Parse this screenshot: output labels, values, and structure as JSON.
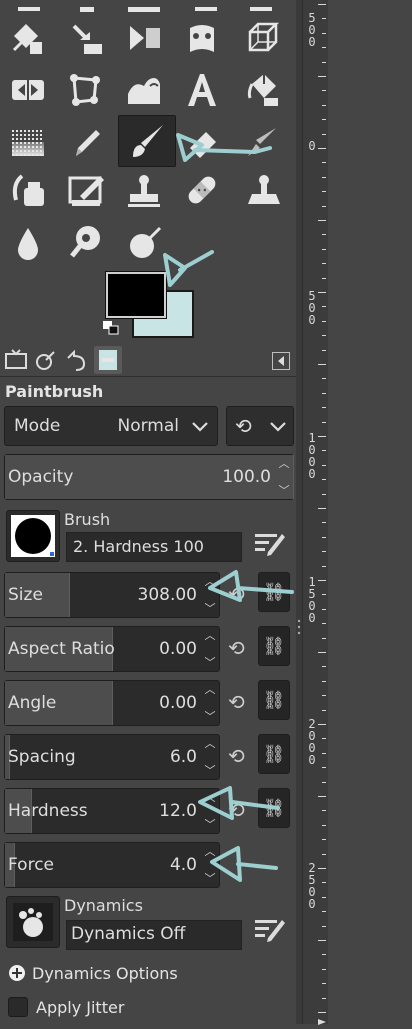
{
  "ruler": {
    "labels": [
      "500",
      "0",
      "500",
      "1000",
      "1500",
      "2000",
      "2500"
    ]
  },
  "tabs": {
    "panel_menu_icon": "panel-menu-icon"
  },
  "tool_options": {
    "title": "Paintbrush",
    "mode": {
      "label": "Mode",
      "value": "Normal"
    },
    "opacity": {
      "label": "Opacity",
      "value": "100.0",
      "fraction": 1.0
    },
    "brush": {
      "label": "Brush",
      "value": "2. Hardness 100"
    },
    "size": {
      "label": "Size",
      "value": "308.00",
      "fraction": 0.3
    },
    "aspect_ratio": {
      "label": "Aspect Ratio",
      "value": "0.00",
      "fraction": 0.5
    },
    "angle": {
      "label": "Angle",
      "value": "0.00",
      "fraction": 0.5
    },
    "spacing": {
      "label": "Spacing",
      "value": "6.0",
      "fraction": 0.02
    },
    "hardness": {
      "label": "Hardness",
      "value": "12.0",
      "fraction": 0.12
    },
    "force": {
      "label": "Force",
      "value": "4.0",
      "fraction": 0.04
    },
    "dynamics": {
      "label": "Dynamics",
      "value": "Dynamics Off"
    },
    "dynamics_options": {
      "label": "Dynamics Options"
    },
    "apply_jitter": {
      "label": "Apply Jitter"
    }
  },
  "colors": {
    "foreground": "#000000",
    "background": "#c8e4e4",
    "annotation": "#9ecfd0"
  }
}
